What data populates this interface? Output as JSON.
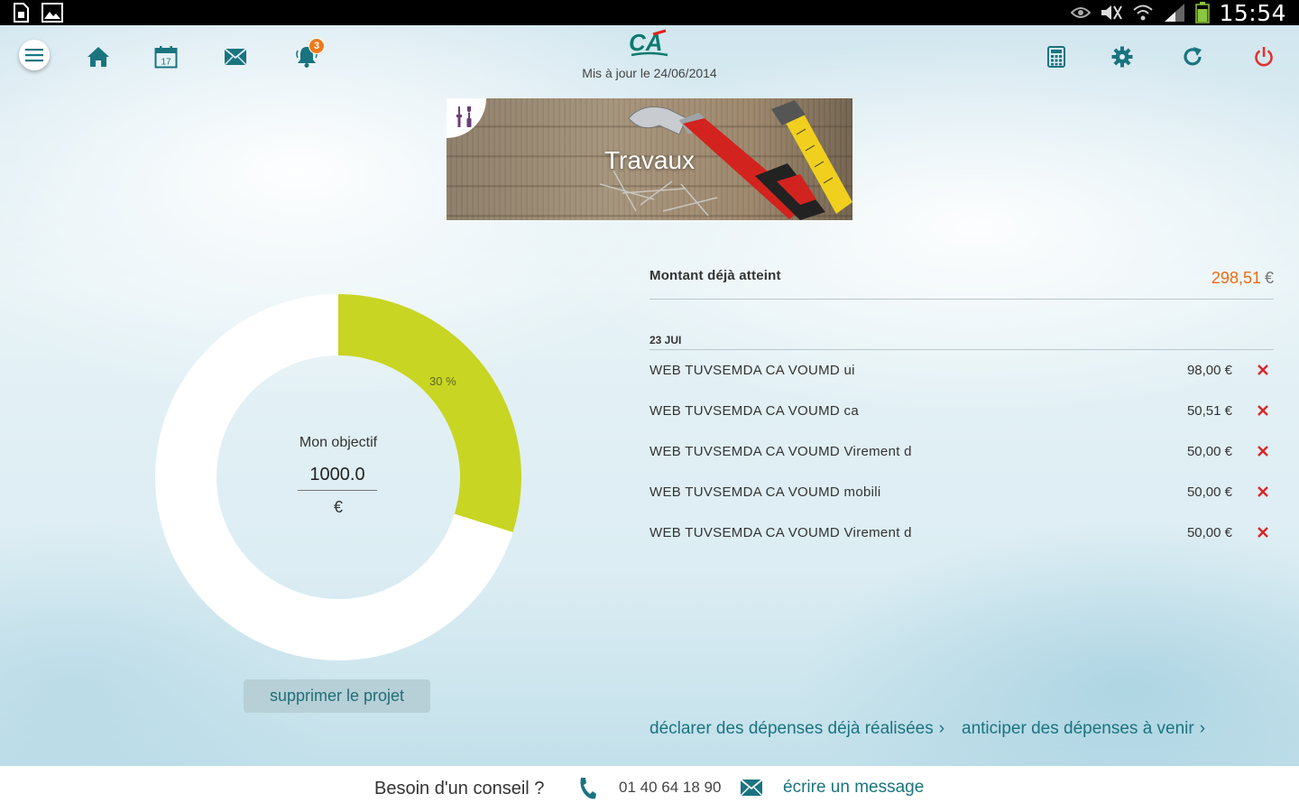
{
  "status_bar": {
    "time": "15:54"
  },
  "header": {
    "updated_text": "Mis à jour le 24/06/2014",
    "notification_count": "3",
    "calendar_day": "17"
  },
  "project": {
    "title": "Travaux"
  },
  "progress": {
    "percent_label": "30 %",
    "fraction": 0.2985,
    "goal_label": "Mon objectif",
    "goal_value": "1000.0",
    "goal_currency": "€",
    "delete_label": "supprimer le projet"
  },
  "summary": {
    "amount_label": "Montant déjà atteint",
    "amount_value": "298,51",
    "amount_currency": "€"
  },
  "transactions_date": "23 JUI",
  "transactions": [
    {
      "label": "WEB TUVSEMDA CA VOUMD ui",
      "amount": "98,00 €"
    },
    {
      "label": "WEB TUVSEMDA CA VOUMD ca",
      "amount": "50,51 €"
    },
    {
      "label": "WEB TUVSEMDA CA VOUMD Virement d",
      "amount": "50,00 €"
    },
    {
      "label": "WEB TUVSEMDA CA VOUMD mobili",
      "amount": "50,00 €"
    },
    {
      "label": "WEB TUVSEMDA CA VOUMD Virement d",
      "amount": "50,00 €"
    }
  ],
  "links": {
    "past_expenses": "déclarer des dépenses déjà réalisées",
    "future_expenses": "anticiper des dépenses à venir"
  },
  "footer": {
    "advice": "Besoin d'un conseil ?",
    "phone": "01 40 64 18 90",
    "write_message": "écrire un message"
  },
  "colors": {
    "teal": "#1a7480",
    "donut_fill": "#c8d523",
    "amount_orange": "#f06a10",
    "power_red": "#e0332f",
    "delete_red": "#d8262b"
  },
  "icons": {
    "status_left": [
      "sim-card-icon",
      "image-icon"
    ],
    "status_right": [
      "eye-icon",
      "mute-icon",
      "wifi-icon",
      "signal-icon",
      "battery-icon"
    ],
    "toolbar_left": [
      "menu-icon",
      "home-icon",
      "calendar-icon",
      "mail-icon",
      "bell-icon"
    ],
    "toolbar_right": [
      "calculator-icon",
      "gear-icon",
      "refresh-icon",
      "power-icon"
    ]
  }
}
